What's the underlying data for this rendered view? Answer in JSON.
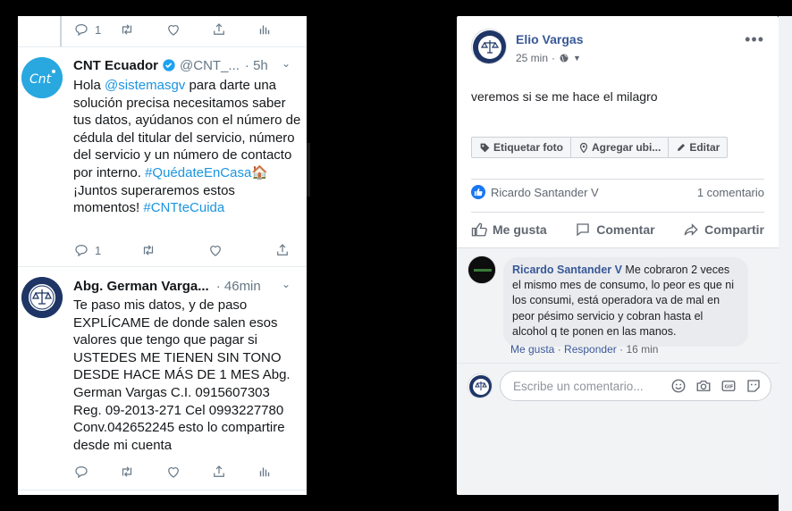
{
  "twitter": {
    "top_actions": {
      "reply_count": "1",
      "retweet_count": "",
      "like_count": ""
    },
    "tweet1": {
      "name": "CNT Ecuador",
      "handle": "@CNT_...",
      "time": "· 5h",
      "avatar_text": "Cnt",
      "body_pre": "Hola ",
      "mention": "@sistemasgv",
      "body_main": " para darte una solución precisa necesitamos saber tus datos, ayúdanos con el número de cédula del titular del servicio, número del servicio y un número de contacto por interno.",
      "hashtag1": "#QuédateEnCasa",
      "emoji": "🏠",
      "body_after": " ¡Juntos superaremos estos momentos!",
      "hashtag2": "#CNTteCuida",
      "reply_count": "1"
    },
    "tweet2": {
      "name": "Abg. German Varga...",
      "time": "· 46min",
      "body": "Te paso mis datos, y de paso EXPLÍCAME de donde salen esos valores que tengo que pagar si USTEDES ME TIENEN SIN TONO DESDE HACE MÁS DE 1 MES Abg. German Vargas C.I. 0915607303 Reg. 09-2013-271 Cel 0993227780 Conv.042652245 esto lo compartire desde mi cuenta"
    },
    "colors": {
      "link": "#1b95e0",
      "text": "#14171a",
      "muted": "#657786"
    }
  },
  "facebook": {
    "author": "Elio Vargas",
    "time": "25 min",
    "post_text": "veremos si se me hace el milagro",
    "tags": [
      "Etiquetar foto",
      "Agregar ubi...",
      "Editar"
    ],
    "reaction_name": "Ricardo Santander V",
    "comment_count": "1 comentario",
    "buttons": {
      "like": "Me gusta",
      "comment": "Comentar",
      "share": "Compartir"
    },
    "comment": {
      "author": "Ricardo Santander V",
      "text": " Me cobraron 2 veces el mismo mes de consumo, lo peor es que ni los consumi, está operadora va de mal en peor pésimo servicio y cobran hasta el alcohol q te ponen en las manos.",
      "like": "Me gusta",
      "reply": "Responder",
      "time": "16 min"
    },
    "input_placeholder": "Escribe un comentario...",
    "colors": {
      "link": "#385898",
      "blue": "#1877f2",
      "muted": "#606770"
    }
  }
}
